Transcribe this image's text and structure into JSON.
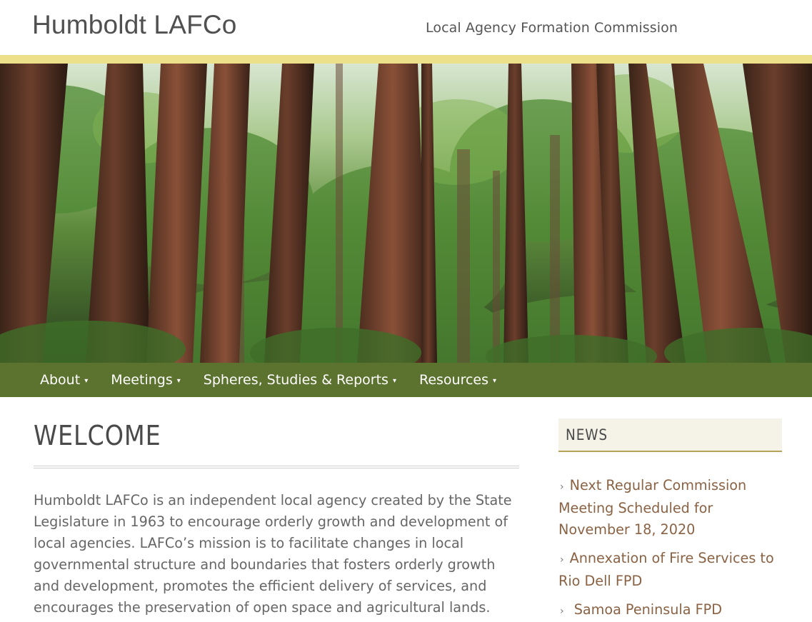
{
  "header": {
    "site_title": "Humboldt LAFCo",
    "tagline": "Local Agency Formation Commission"
  },
  "colors": {
    "stripe": "#ece18a",
    "nav_bg": "#5c722f",
    "news_underline": "#b7a25a",
    "link": "#8a6244"
  },
  "hero": {
    "icon": "redwood-forest-banner"
  },
  "nav": {
    "items": [
      {
        "label": "About",
        "caret": "▾"
      },
      {
        "label": "Meetings",
        "caret": "▾"
      },
      {
        "label": "Spheres, Studies & Reports",
        "caret": "▾"
      },
      {
        "label": "Resources",
        "caret": "▾"
      }
    ]
  },
  "main": {
    "title": "WELCOME",
    "intro": "Humboldt LAFCo is an independent local agency created by the State Legislature in 1963 to encourage orderly growth and development of local agencies. LAFCo’s mission is to facilitate changes in local governmental structure and boundaries that fosters orderly growth and development, promotes the efficient delivery of services, and encourages the preservation of open space and agricultural lands. LAFCo seeks to be proactive in raising"
  },
  "sidebar": {
    "heading": "NEWS",
    "chevron": "›",
    "items": [
      {
        "label": "Next Regular Commission Meeting Scheduled for November 18, 2020"
      },
      {
        "label": "Annexation of Fire Services to Rio Dell FPD"
      },
      {
        "label": " Samoa Peninsula FPD"
      }
    ]
  }
}
